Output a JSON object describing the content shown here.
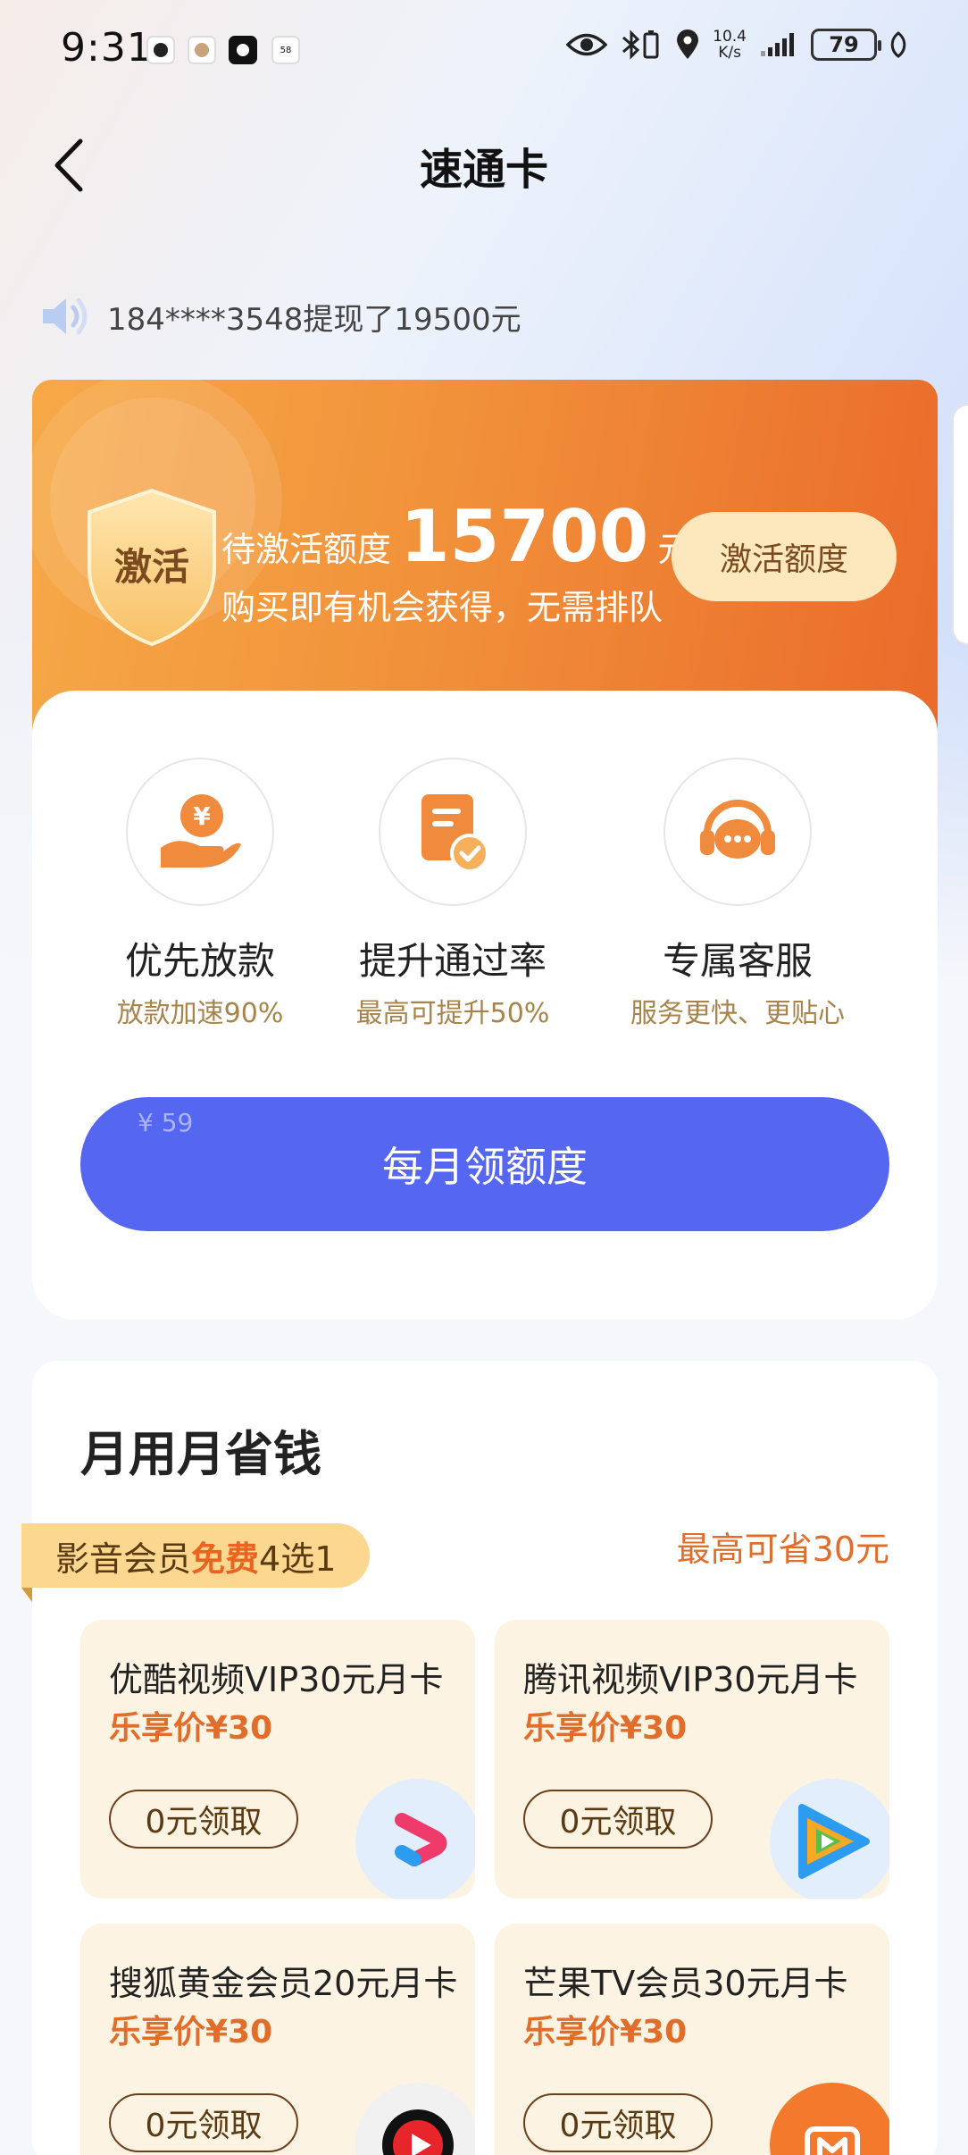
{
  "status_bar": {
    "time": "9:31",
    "net_speed_value": "10.4",
    "net_speed_unit": "K/s",
    "battery": "79"
  },
  "header": {
    "title": "速通卡"
  },
  "ticker": {
    "text": "184****3548提现了19500元"
  },
  "promo": {
    "badge": "激活",
    "label": "待激活额度",
    "amount": "15700",
    "unit": "元",
    "subtitle": "购买即有机会获得，无需排队",
    "button": "激活额度"
  },
  "benefits": [
    {
      "name": "优先放款",
      "desc": "放款加速90%",
      "icon": "yuan-hand-icon"
    },
    {
      "name": "提升通过率",
      "desc": "最高可提升50%",
      "icon": "document-check-icon"
    },
    {
      "name": "专属客服",
      "desc": "服务更快、更贴心",
      "icon": "headset-icon"
    }
  ],
  "cta": {
    "price": "¥ 59",
    "label": "每月领额度"
  },
  "savings": {
    "title": "月用月省钱",
    "tag_prefix": "影音会员 ",
    "tag_highlight": "免费",
    "tag_suffix": "4选1",
    "max_save": "最高可省30元",
    "offers": [
      {
        "name": "优酷视频VIP30元月卡",
        "price": "乐享价¥30",
        "button": "0元领取",
        "icon": "youku-icon"
      },
      {
        "name": "腾讯视频VIP30元月卡",
        "price": "乐享价¥30",
        "button": "0元领取",
        "icon": "tencent-video-icon"
      },
      {
        "name": "搜狐黄金会员20元月卡",
        "price": "乐享价¥30",
        "button": "0元领取",
        "icon": "sohu-video-icon"
      },
      {
        "name": "芒果TV会员30元月卡",
        "price": "乐享价¥30",
        "button": "0元领取",
        "icon": "mango-tv-icon"
      }
    ]
  },
  "colors": {
    "orange_start": "#f6a947",
    "orange_end": "#ea6a2a",
    "cta_blue": "#5566f0",
    "gold_text": "#a8844a",
    "price_orange": "#e06d2a"
  }
}
